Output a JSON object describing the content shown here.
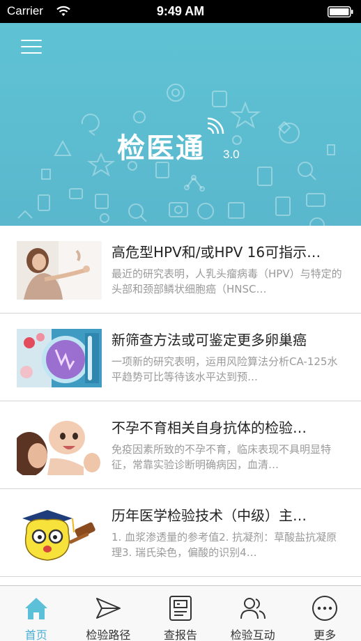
{
  "status_bar": {
    "carrier": "Carrier",
    "time": "9:49 AM"
  },
  "banner": {
    "logo_text": "检医通",
    "version": "3.0",
    "background_color": "#5fc3d4"
  },
  "articles": [
    {
      "title": "高危型HPV和/或HPV 16可指示…",
      "summary": "最近的研究表明，人乳头瘤病毒（HPV）与特定的头部和颈部鳞状细胞癌（HNSC…",
      "thumb_icon": "woman-with-child-photo"
    },
    {
      "title": "新筛查方法或可鉴定更多卵巢癌",
      "summary": "一项新的研究表明，运用风险算法分析CA-125水平趋势可比等待该水平达到预…",
      "thumb_icon": "lab-petri-dish-photo"
    },
    {
      "title": "不孕不育相关自身抗体的检验…",
      "summary": "免疫因素所致的不孕不育，临床表现不具明显特征，常靠实验诊断明确病因，血清…",
      "thumb_icon": "mother-kissing-baby-photo"
    },
    {
      "title": "历年医学检验技术（中级）主…",
      "summary": "1. 血浆渗透量的参考值2. 抗凝剂：草酸盐抗凝原理3. 瑞氏染色，偏酸的识别4…",
      "thumb_icon": "graduate-cartoon-with-gavel"
    }
  ],
  "tabbar": {
    "accent_color": "#4aaed4",
    "tabs": [
      {
        "label": "首页",
        "icon": "home-icon",
        "active": true
      },
      {
        "label": "检验路径",
        "icon": "send-icon",
        "active": false
      },
      {
        "label": "查报告",
        "icon": "report-icon",
        "active": false
      },
      {
        "label": "检验互动",
        "icon": "users-icon",
        "active": false
      },
      {
        "label": "更多",
        "icon": "more-icon",
        "active": false
      }
    ]
  }
}
